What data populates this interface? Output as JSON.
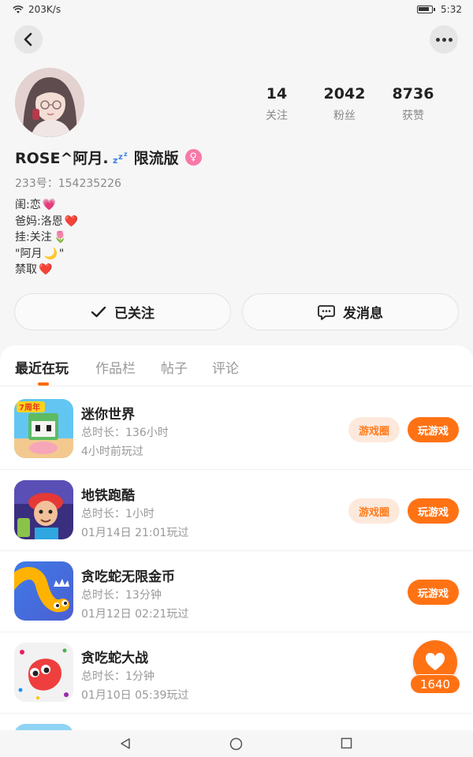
{
  "status_bar": {
    "network_speed": "203K/s",
    "time": "5:32",
    "icons": [
      "wifi-icon",
      "battery-icon"
    ]
  },
  "profile": {
    "stats": [
      {
        "value": "14",
        "label": "关注"
      },
      {
        "value": "2042",
        "label": "粉丝"
      },
      {
        "value": "8736",
        "label": "获赞"
      }
    ],
    "name_part1": "ROSE^阿月.",
    "name_part2": "限流版",
    "gender_symbol": "♀",
    "uid": "233号：154235226",
    "bio": [
      {
        "text": "闺:恋",
        "emoji": "💗"
      },
      {
        "text": "爸妈:洛恩",
        "emoji": "❤️"
      },
      {
        "text": "挂:关注",
        "emoji": "🌷"
      },
      {
        "text": "\"阿月",
        "emoji": "🌙",
        "suffix": "\""
      },
      {
        "text": "禁取",
        "emoji": "❤️"
      }
    ],
    "follow_button": "已关注",
    "message_button": "发消息"
  },
  "tabs": [
    "最近在玩",
    "作品栏",
    "帖子",
    "评论"
  ],
  "active_tab": 0,
  "games": [
    {
      "name": "迷你世界",
      "duration": "总时长：136小时",
      "last_played": "4小时前玩过",
      "circle_label": "游戏圈",
      "play_label": "玩游戏"
    },
    {
      "name": "地铁跑酷",
      "duration": "总时长：1小时",
      "last_played": "01月14日 21:01玩过",
      "circle_label": "游戏圈",
      "play_label": "玩游戏"
    },
    {
      "name": "贪吃蛇无限金币",
      "duration": "总时长：13分钟",
      "last_played": "01月12日 02:21玩过",
      "play_label": "玩游戏"
    },
    {
      "name": "贪吃蛇大战",
      "duration": "总时长：1分钟",
      "last_played": "01月10日 05:39玩过"
    }
  ],
  "icon_badge": "7周年",
  "like_count": "1640",
  "colors": {
    "accent": "#ff7214",
    "accent_soft": "#fde9dc",
    "gender": "#f779a8"
  }
}
